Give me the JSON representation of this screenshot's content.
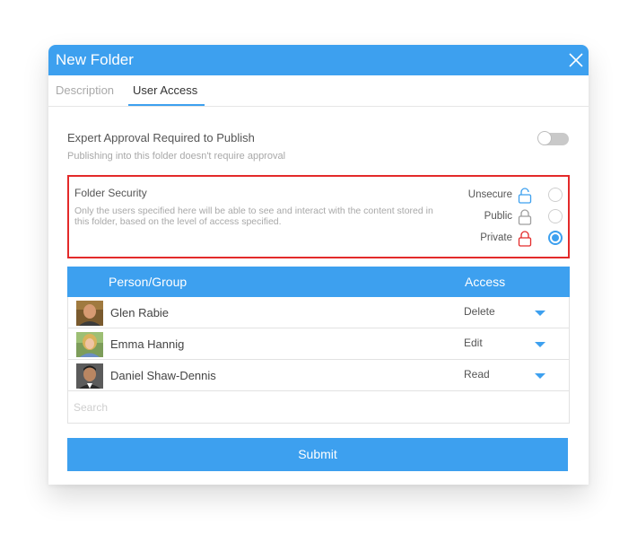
{
  "dialog": {
    "title": "New Folder",
    "close_icon": "close-icon"
  },
  "tabs": [
    {
      "label": "Description",
      "active": false
    },
    {
      "label": "User Access",
      "active": true
    }
  ],
  "approval": {
    "title": "Expert Approval Required to Publish",
    "subtitle": "Publishing into this folder doesn't require approval",
    "enabled": false
  },
  "security": {
    "title": "Folder Security",
    "description": "Only the users specified here will be able to see and interact with the content stored in this folder, based on the level of access specified.",
    "options": [
      {
        "label": "Unsecure",
        "icon": "unlocked-icon",
        "color": "#3da0ef",
        "selected": false
      },
      {
        "label": "Public",
        "icon": "lock-icon",
        "color": "#9e9e9e",
        "selected": false
      },
      {
        "label": "Private",
        "icon": "lock-icon",
        "color": "#e32a2a",
        "selected": true
      }
    ]
  },
  "table": {
    "columns": [
      "Person/Group",
      "Access"
    ],
    "rows": [
      {
        "name": "Glen Rabie",
        "access": "Delete"
      },
      {
        "name": "Emma Hannig",
        "access": "Edit"
      },
      {
        "name": "Daniel Shaw-Dennis",
        "access": "Read"
      }
    ],
    "search_placeholder": "Search"
  },
  "submit_label": "Submit",
  "colors": {
    "accent": "#3da0ef",
    "highlight": "#e32a2a"
  }
}
